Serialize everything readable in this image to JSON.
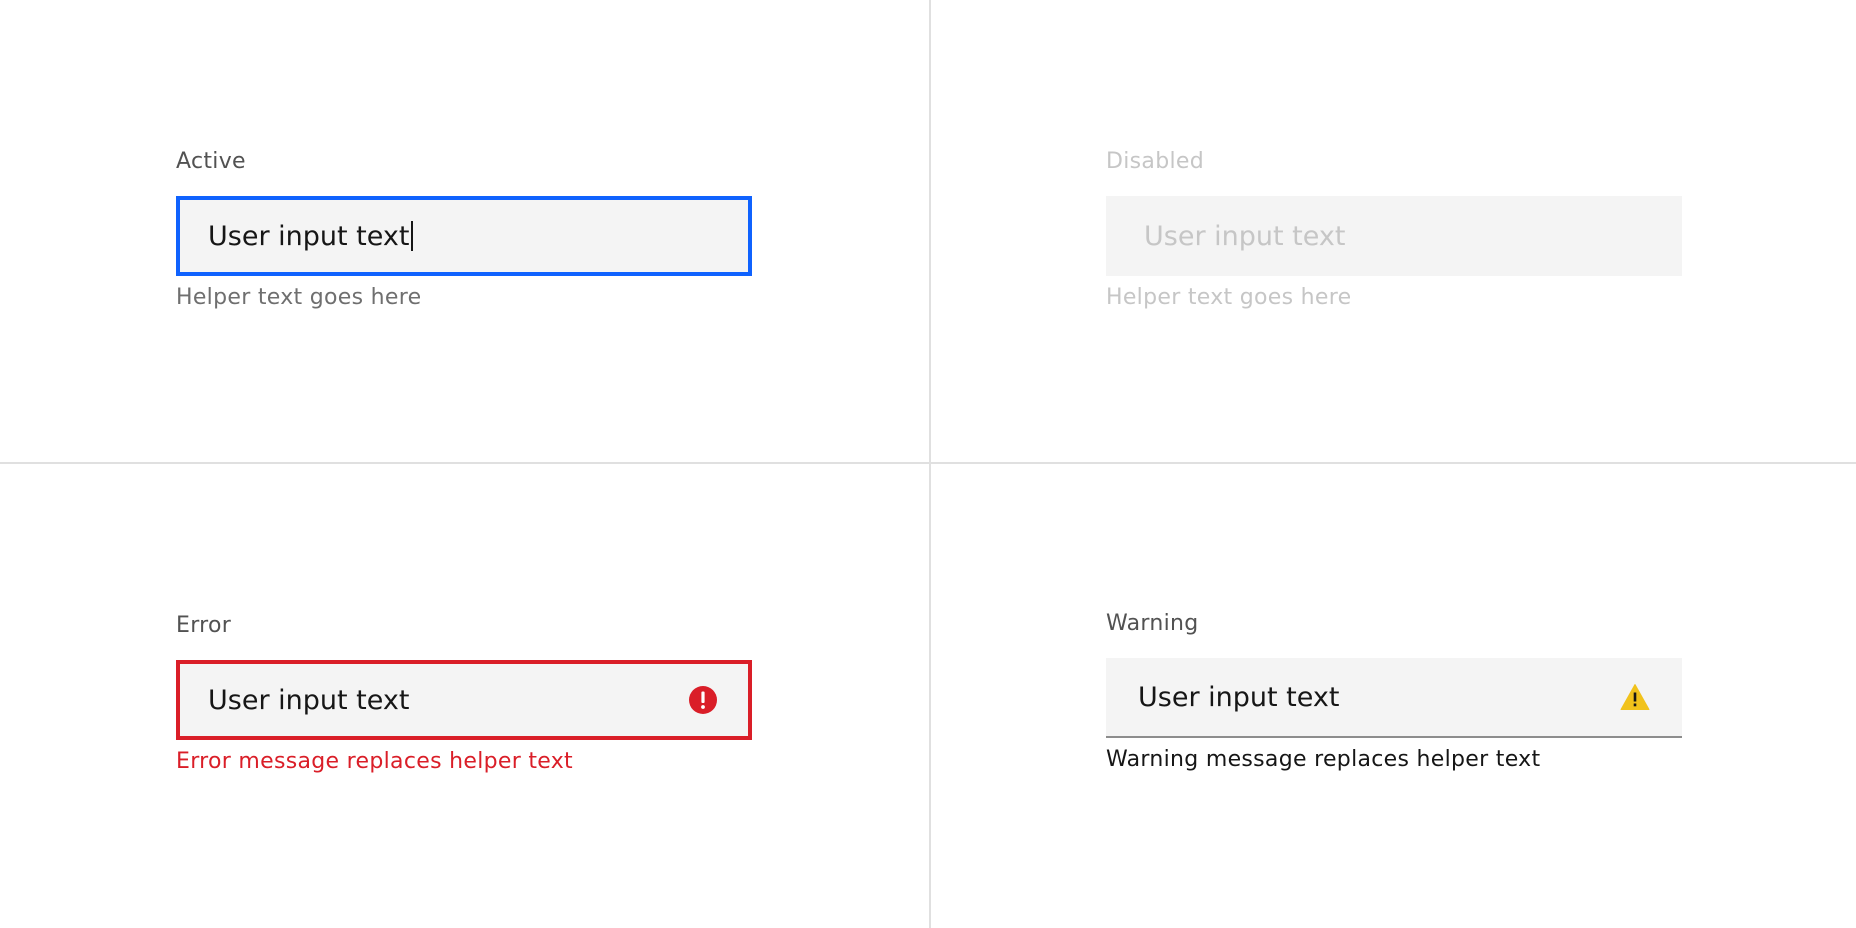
{
  "colors": {
    "focus": "#0f62fe",
    "error": "#da1e28",
    "warning": "#f1c21b",
    "field_background": "#f4f4f4",
    "text_primary": "#161616",
    "text_secondary": "#525252",
    "text_helper": "#6f6f6f",
    "text_disabled": "#c6c6c6",
    "divider": "#e0e0e0"
  },
  "fields": {
    "active": {
      "label": "Active",
      "value": "User input text",
      "helper": "Helper text goes here"
    },
    "disabled": {
      "label": "Disabled",
      "value": "User input text",
      "helper": "Helper text goes here"
    },
    "error": {
      "label": "Error",
      "value": "User input text",
      "message": "Error message replaces helper text",
      "icon": "error-filled-icon"
    },
    "warning": {
      "label": "Warning",
      "value": "User input text",
      "message": "Warning message replaces helper text",
      "icon": "warning-triangle-icon"
    }
  }
}
